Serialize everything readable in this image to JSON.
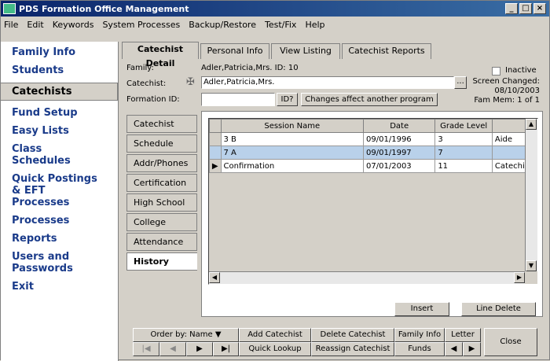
{
  "titlebar": {
    "title": "PDS Formation Office Management",
    "minimize": "_",
    "maximize": "□",
    "close": "×"
  },
  "menu": [
    "File",
    "Edit",
    "Keywords",
    "System Processes",
    "Backup/Restore",
    "Test/Fix",
    "Help"
  ],
  "sidebar": {
    "items": [
      {
        "label": "Family Info"
      },
      {
        "label": "Students"
      },
      {
        "label": "Catechists"
      },
      {
        "label": "Fund Setup"
      },
      {
        "label": "Easy Lists"
      },
      {
        "label": "Class Schedules"
      },
      {
        "label": "Quick Postings & EFT Processes"
      },
      {
        "label": "Processes"
      },
      {
        "label": "Reports"
      },
      {
        "label": "Users and Passwords"
      },
      {
        "label": "Exit"
      }
    ],
    "active_index": 2
  },
  "tabs": [
    "Catechist Detail",
    "Personal Info",
    "View Listing",
    "Catechist Reports"
  ],
  "detail": {
    "family_label": "Family:",
    "family_value": "Adler,Patricia,Mrs.  ID: 10",
    "catechist_label": "Catechist:",
    "catechist_value": "Adler,Patricia,Mrs.",
    "formation_label": "Formation ID:",
    "formation_value": "",
    "id_btn": "ID?",
    "changes_btn": "Changes affect another program",
    "ellipsis": "...",
    "inactive_label": "Inactive",
    "screen_changed": "Screen Changed:",
    "screen_changed_date": "08/10/2003",
    "fam_mem": "Fam Mem: 1 of 1"
  },
  "subtabs": [
    "Catechist",
    "Schedule",
    "Addr/Phones",
    "Certification",
    "High School",
    "College",
    "Attendance",
    "History"
  ],
  "history": {
    "columns": [
      "Session Name",
      "Date",
      "Grade Level",
      ""
    ],
    "rows": [
      [
        "3 B",
        "09/01/1996",
        "3",
        "Aide"
      ],
      [
        "7 A",
        "09/01/1997",
        "7",
        ""
      ],
      [
        "Confirmation",
        "07/01/2003",
        "11",
        "Catechis"
      ]
    ],
    "insert_btn": "Insert",
    "delete_btn": "Line Delete"
  },
  "bottom": {
    "order_by": "Order by:  Name ▼",
    "add": "Add Catechist",
    "delete": "Delete Catechist",
    "family": "Family Info",
    "letter": "Letter",
    "close": "Close",
    "quick": "Quick Lookup",
    "reassign": "Reassign Catechist",
    "funds": "Funds",
    "first": "|◀",
    "prev": "◀",
    "next": "▶",
    "last": "▶|",
    "left": "◀",
    "right": "▶"
  }
}
